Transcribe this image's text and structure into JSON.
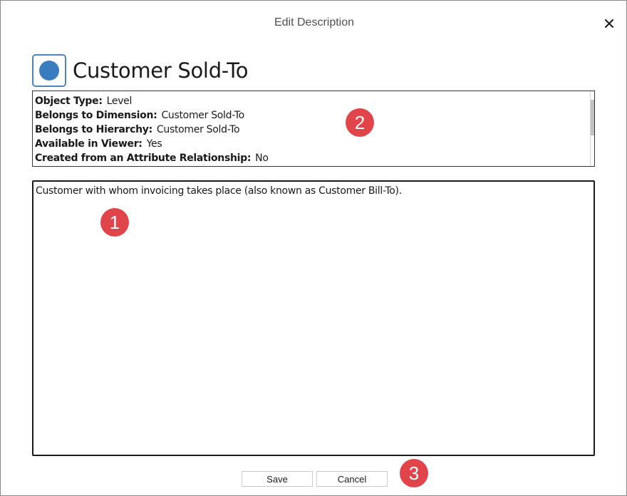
{
  "dialog": {
    "title": "Edit Description",
    "close_icon": "close-icon"
  },
  "object": {
    "icon": "level-circle-icon",
    "icon_color": "#3a7cc0",
    "name": "Customer Sold-To"
  },
  "info": {
    "rows": [
      {
        "label": "Object Type:",
        "value": "Level"
      },
      {
        "label": "Belongs to Dimension:",
        "value": "Customer Sold-To"
      },
      {
        "label": "Belongs to Hierarchy:",
        "value": "Customer Sold-To"
      },
      {
        "label": "Available in Viewer:",
        "value": "Yes"
      },
      {
        "label": "Created from an Attribute Relationship:",
        "value": "No"
      }
    ]
  },
  "description": {
    "value": "Customer with whom invoicing takes place (also known as Customer Bill-To)."
  },
  "buttons": {
    "save_label": "Save",
    "cancel_label": "Cancel"
  },
  "callouts": {
    "one": "1",
    "two": "2",
    "three": "3",
    "color": "#e0454b"
  }
}
